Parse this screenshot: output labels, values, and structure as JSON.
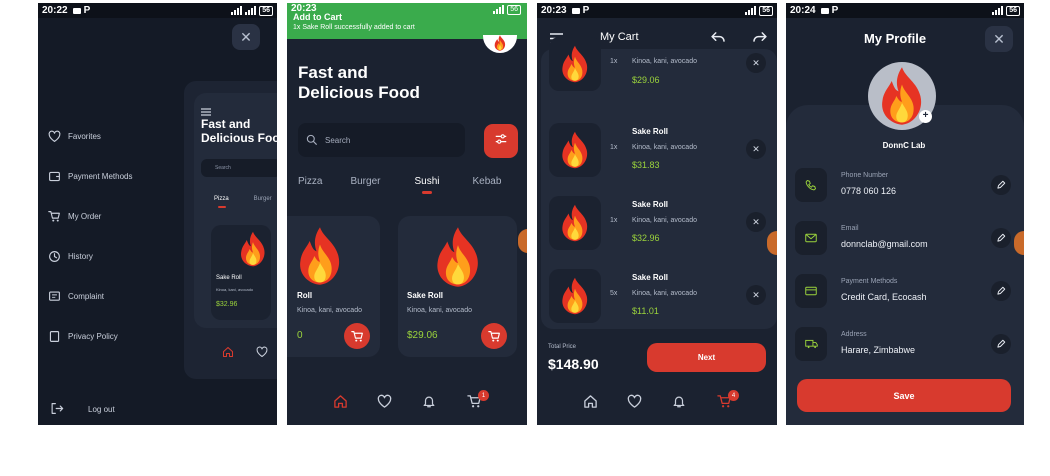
{
  "colors": {
    "accent": "#d83a2e",
    "price": "#9bd43c",
    "background": "#1b2230",
    "card": "#232b3b",
    "toast": "#3aab4c"
  },
  "screen1": {
    "status_time": "20:22",
    "menu": [
      {
        "label": "Favorites",
        "icon": "heart-outline-icon"
      },
      {
        "label": "Payment Methods",
        "icon": "wallet-icon"
      },
      {
        "label": "My Order",
        "icon": "cart-icon"
      },
      {
        "label": "History",
        "icon": "history-icon"
      },
      {
        "label": "Complaint",
        "icon": "message-icon"
      },
      {
        "label": "Privacy Policy",
        "icon": "document-icon"
      }
    ],
    "logout_label": "Log out",
    "preview": {
      "title": "Fast and Delicious Food",
      "search_placeholder": "Search",
      "tabs": [
        "Pizza",
        "Burger"
      ],
      "item_name": "Sake Roll",
      "item_desc": "Kinoa, kani, avocado",
      "item_price": "$32.96"
    }
  },
  "screen2": {
    "status_time": "20:23",
    "toast_title": "Add to Cart",
    "toast_message": "1x Sake Roll successfully added to cart",
    "headline": "Fast and Delicious Food",
    "search_placeholder": "Search",
    "categories": [
      "Pizza",
      "Burger",
      "Sushi",
      "Kebab"
    ],
    "active_category": "Sushi",
    "cards": [
      {
        "name": "Roll",
        "desc": "Kinoa, kani, avocado",
        "price": "0"
      },
      {
        "name": "Sake Roll",
        "desc": "Kinoa, kani, avocado",
        "price": "$29.06"
      }
    ],
    "cart_badge": "1"
  },
  "screen3": {
    "status_time": "20:23",
    "title": "My Cart",
    "items": [
      {
        "qty": "1x",
        "name": "",
        "desc": "Kinoa, kani, avocado",
        "price": "$29.06"
      },
      {
        "qty": "1x",
        "name": "Sake Roll",
        "desc": "Kinoa, kani, avocado",
        "price": "$31.83"
      },
      {
        "qty": "1x",
        "name": "Sake Roll",
        "desc": "Kinoa, kani, avocado",
        "price": "$32.96"
      },
      {
        "qty": "5x",
        "name": "Sake Roll",
        "desc": "Kinoa, kani, avocado",
        "price": "$11.01"
      }
    ],
    "total_label": "Total Price",
    "total_value": "$148.90",
    "next_label": "Next",
    "cart_badge": "4"
  },
  "screen4": {
    "status_time": "20:24",
    "title": "My Profile",
    "name": "DonnC Lab",
    "fields": [
      {
        "label": "Phone Number",
        "value": "0778 060 126",
        "icon": "phone-icon"
      },
      {
        "label": "Email",
        "value": "donnclab@gmail.com",
        "icon": "mail-icon"
      },
      {
        "label": "Payment Methods",
        "value": "Credit Card, Ecocash",
        "icon": "card-icon"
      },
      {
        "label": "Address",
        "value": "Harare, Zimbabwe",
        "icon": "truck-icon"
      }
    ],
    "save_label": "Save"
  }
}
